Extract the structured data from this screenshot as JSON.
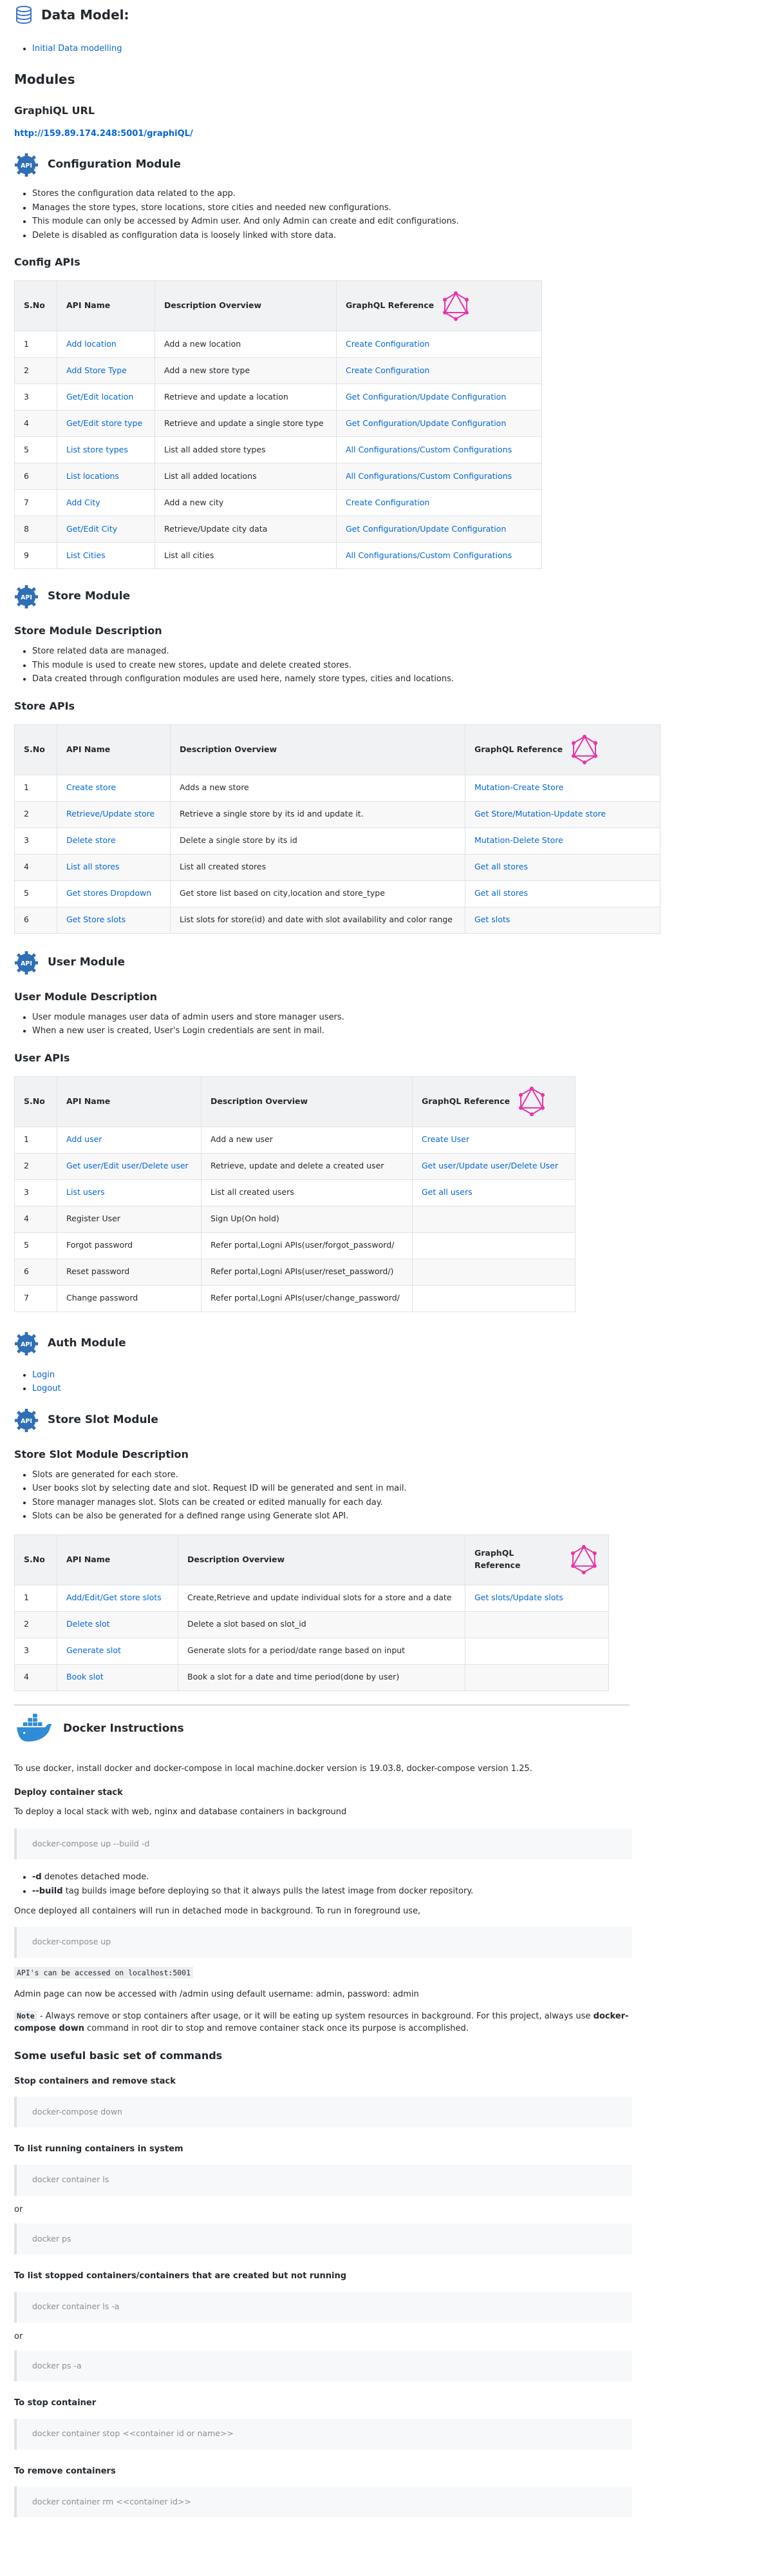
{
  "data_model": {
    "title": "Data Model:",
    "items": [
      "Initial Data modelling"
    ]
  },
  "modules_title": "Modules",
  "graphiql": {
    "title": "GraphiQL URL",
    "url": "http://159.89.174.248:5001/graphiQL/"
  },
  "config_module": {
    "title": "Configuration Module",
    "bullets": [
      "Stores the configuration data related to the app.",
      "Manages the store types, store locations, store cities and needed new configurations.",
      "This module can only be accessed by Admin user. And only Admin can create and edit configurations.",
      "Delete is disabled as configuration data is loosely linked with store data."
    ],
    "apis_title": "Config APIs",
    "headers": [
      "S.No",
      "API Name",
      "Description Overview",
      "GraphQL Reference"
    ],
    "rows": [
      [
        "1",
        "Add location",
        "Add a new location",
        "Create Configuration"
      ],
      [
        "2",
        "Add Store Type",
        "Add a new store type",
        "Create Configuration"
      ],
      [
        "3",
        "Get/Edit location",
        "Retrieve and update a location",
        "Get Configuration/Update Configuration"
      ],
      [
        "4",
        "Get/Edit store type",
        "Retrieve and update a single store type",
        "Get Configuration/Update Configuration"
      ],
      [
        "5",
        "List store types",
        "List all added store types",
        "All Configurations/Custom Configurations"
      ],
      [
        "6",
        "List locations",
        "List all added locations",
        "All Configurations/Custom Configurations"
      ],
      [
        "7",
        "Add City",
        "Add a new city",
        "Create Configuration"
      ],
      [
        "8",
        "Get/Edit City",
        "Retrieve/Update city data",
        "Get Configuration/Update Configuration"
      ],
      [
        "9",
        "List Cities",
        "List all cities",
        "All Configurations/Custom Configurations"
      ]
    ]
  },
  "store_module": {
    "title": "Store Module",
    "desc_title": "Store Module Description",
    "bullets": [
      "Store related data are managed.",
      "This module is used to create new stores, update and delete created stores.",
      "Data created through configuration modules are used here, namely store types, cities and locations."
    ],
    "apis_title": "Store APIs",
    "headers": [
      "S.No",
      "API Name",
      "Description Overview",
      "GraphQL Reference"
    ],
    "rows": [
      [
        "1",
        "Create store",
        "Adds a new store",
        "Mutation-Create Store"
      ],
      [
        "2",
        "Retrieve/Update store",
        "Retrieve a single store by its id and update it.",
        "Get Store/Mutation-Update store"
      ],
      [
        "3",
        "Delete store",
        "Delete a single store by its id",
        "Mutation-Delete Store"
      ],
      [
        "4",
        "List all stores",
        "List all created stores",
        "Get all stores"
      ],
      [
        "5",
        "Get stores Dropdown",
        "Get store list based on city,location and store_type",
        "Get all stores"
      ],
      [
        "6",
        "Get Store slots",
        "List slots for store(id) and date with slot availability and color range",
        "Get slots"
      ]
    ]
  },
  "user_module": {
    "title": "User Module",
    "desc_title": "User Module Description",
    "bullets": [
      "User module manages user data of admin users and store manager users.",
      "When a new user is created, User's Login credentials are sent in mail."
    ],
    "apis_title": "User APIs",
    "headers": [
      "S.No",
      "API Name",
      "Description Overview",
      "GraphQL Reference"
    ],
    "rows": [
      [
        "1",
        "Add user",
        "Add a new user",
        "Create User"
      ],
      [
        "2",
        "Get user/Edit user/Delete user",
        "Retrieve, update and delete a created user",
        "Get user/Update user/Delete User"
      ],
      [
        "3",
        "List users",
        "List all created users",
        "Get all users"
      ],
      [
        "4",
        "Register User",
        "Sign Up(On hold)",
        ""
      ],
      [
        "5",
        "Forgot password",
        "Refer portal,Logni APIs(user/forgot_password/",
        ""
      ],
      [
        "6",
        "Reset password",
        "Refer portal,Logni APIs(user/reset_password/)",
        ""
      ],
      [
        "7",
        "Change password",
        "Refer portal,Logni APIs(user/change_password/",
        ""
      ]
    ]
  },
  "auth_module": {
    "title": "Auth Module",
    "items": [
      "Login",
      "Logout"
    ]
  },
  "slot_module": {
    "title": "Store Slot Module",
    "desc_title": "Store Slot Module Description",
    "bullets": [
      "Slots are generated for each store.",
      "User books slot by selecting date and slot. Request ID will be generated and sent in mail.",
      "Store manager manages slot. Slots can be created or edited manually for each day.",
      "Slots can be also be generated for a defined range using Generate slot API."
    ],
    "headers": [
      "S.No",
      "API Name",
      "Description Overview",
      "GraphQL Reference"
    ],
    "rows": [
      [
        "1",
        "Add/Edit/Get store slots",
        "Create,Retrieve and update individual slots for a store and a date",
        "Get slots/Update slots"
      ],
      [
        "2",
        "Delete slot",
        "Delete a slot based on slot_id",
        ""
      ],
      [
        "3",
        "Generate slot",
        "Generate slots for a period/date range based on input",
        ""
      ],
      [
        "4",
        "Book slot",
        "Book a slot for a date and time period(done by user)",
        ""
      ]
    ]
  },
  "docker": {
    "title": "Docker Instructions",
    "intro": "To use docker, install docker and docker-compose in local machine.docker version is 19.03.8, docker-compose version 1.25.",
    "deploy_title": "Deploy container stack",
    "deploy_text": "To deploy a local stack with web, nginx and database containers in background",
    "cmd_up_d": "docker-compose up --build -d",
    "flag_d": "-d",
    "flag_d_text": " denotes detached mode.",
    "flag_build": "--build",
    "flag_build_text": " tag builds image before deploying so that it always pulls the latest image from docker repository.",
    "fg_text": "Once deployed all containers will run in detached mode in background. To run in foreground use,",
    "cmd_up": "docker-compose up",
    "api_access": "API's can be accessed on localhost:5001",
    "admin_text": "Admin page can now be accessed with /admin using default username: admin, password: admin",
    "note_label": "Note",
    "note_text_1": " - Always remove or stop containers after usage, or it will be eating up system resources in background. For this project, always use ",
    "note_bold_1": "docker-compose down",
    "note_text_2": " command in root dir to stop and remove container stack once its purpose is accomplished.",
    "commands_title": "Some useful basic set of commands",
    "stop_remove_title": "Stop containers and remove stack",
    "cmd_down": "docker-compose down",
    "list_running_title": "To list running containers in system",
    "cmd_ls": "docker container ls",
    "or1": "or",
    "cmd_ps": "docker ps",
    "list_stopped_title": "To list stopped containers/containers that are created but not running",
    "cmd_ls_a": "docker container ls -a",
    "or2": "or",
    "cmd_ps_a": "docker ps -a",
    "stop_title": "To stop container",
    "cmd_stop": "docker container stop <<container id or name>>",
    "remove_title": "To remove containers",
    "cmd_rm": "docker container rm <<container id>>"
  }
}
